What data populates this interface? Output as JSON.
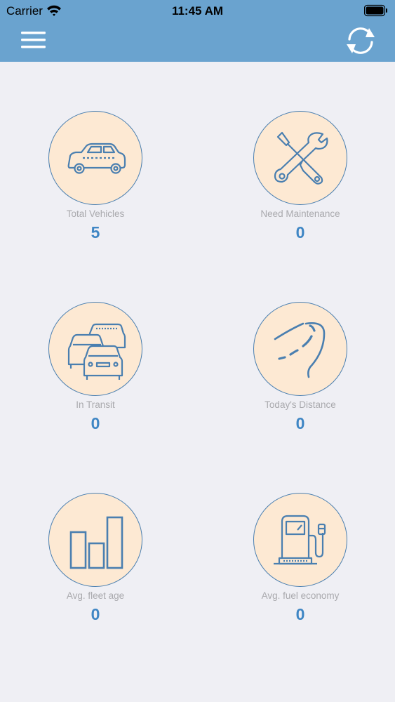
{
  "status_bar": {
    "carrier": "Carrier",
    "time": "11:45 AM"
  },
  "header": {
    "menu_icon": "hamburger-menu-icon",
    "refresh_icon": "refresh-icon"
  },
  "stats": [
    {
      "label": "Total Vehicles",
      "value": "5",
      "icon": "car-icon"
    },
    {
      "label": "Need Maintenance",
      "value": "0",
      "icon": "wrench-screwdriver-icon"
    },
    {
      "label": "In Transit",
      "value": "0",
      "icon": "traffic-cars-icon"
    },
    {
      "label": "Today's Distance",
      "value": "0",
      "icon": "road-icon"
    },
    {
      "label": "Avg. fleet age",
      "value": "0",
      "icon": "bar-chart-icon"
    },
    {
      "label": "Avg. fuel economy",
      "value": "0",
      "icon": "fuel-pump-icon"
    }
  ],
  "colors": {
    "header": "#6aa3cf",
    "accent": "#3f86c4",
    "circle_fill": "#fde9d3",
    "background": "#efeff4"
  }
}
